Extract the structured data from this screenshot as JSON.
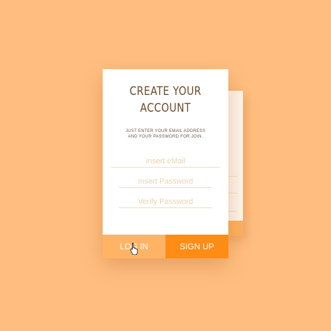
{
  "form": {
    "title_line1": "CREATE YOUR",
    "title_line2": "ACCOUNT",
    "subtitle_line1": "JUST ENTER YOUR EMAIL ADDRESS",
    "subtitle_line2": "AND YOUR PASSWORD FOR JOIN.",
    "email_placeholder": "Insert eMail",
    "password_placeholder": "Insert Password",
    "verify_placeholder": "Verify Password"
  },
  "actions": {
    "login_label": "LOG IN",
    "signup_label": "SIGN UP"
  },
  "colors": {
    "background": "#ffbe80",
    "card": "#ffffff",
    "title": "#6e4a28",
    "login_button": "#ffb365",
    "signup_button": "#ff8c14"
  },
  "icons": {
    "pointer": "hand-pointer-icon"
  }
}
